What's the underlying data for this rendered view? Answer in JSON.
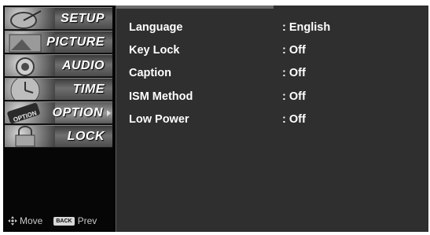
{
  "menu": [
    {
      "label": "SETUP",
      "active": false
    },
    {
      "label": "PICTURE",
      "active": false
    },
    {
      "label": "AUDIO",
      "active": false
    },
    {
      "label": "TIME",
      "active": false
    },
    {
      "label": "OPTION",
      "active": true
    },
    {
      "label": "LOCK",
      "active": false
    }
  ],
  "footer": {
    "move_label": "Move",
    "back_key": "BACK",
    "prev_label": "Prev"
  },
  "settings": [
    {
      "label": "Language",
      "value": ": English"
    },
    {
      "label": "Key Lock",
      "value": ": Off"
    },
    {
      "label": "Caption",
      "value": ": Off"
    },
    {
      "label": "ISM Method",
      "value": ": Off"
    },
    {
      "label": "Low Power",
      "value": ": Off"
    }
  ],
  "thumbnail_words": {
    "option": "OPTION"
  },
  "colors": {
    "panel": "#2f2f2f",
    "sidebar": "#060606",
    "text": "#ffffff"
  }
}
